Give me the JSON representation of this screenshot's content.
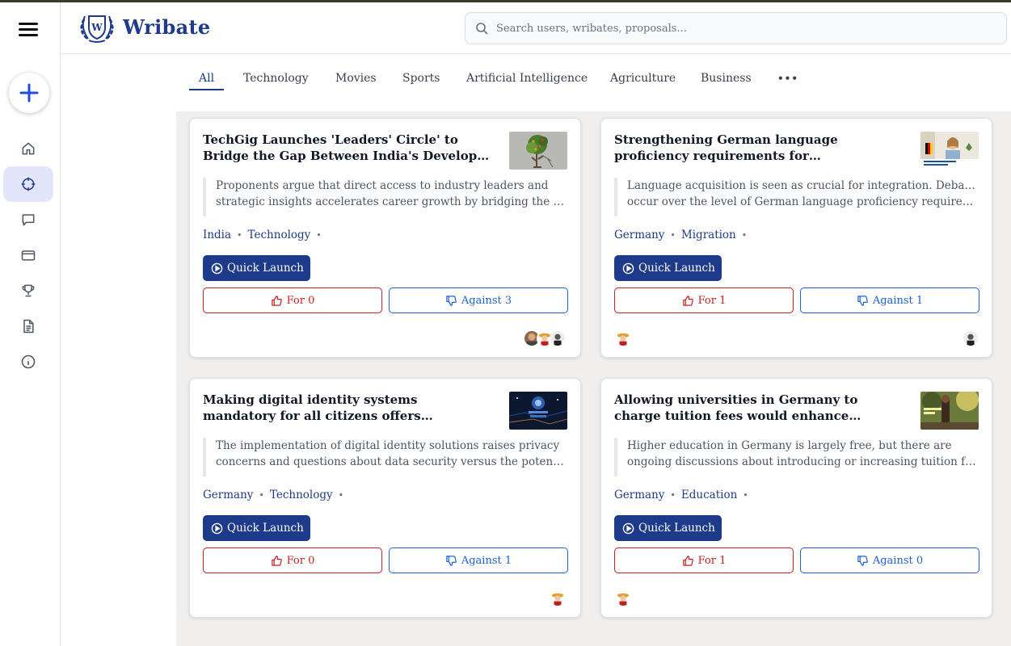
{
  "app": {
    "brand": "Wribate",
    "logo_letter": "W"
  },
  "search": {
    "placeholder": "Search users, wribates, proposals..."
  },
  "sidebar": {
    "items": [
      {
        "name": "home-icon"
      },
      {
        "name": "crosshair-icon",
        "active": true
      },
      {
        "name": "chat-icon"
      },
      {
        "name": "card-icon"
      },
      {
        "name": "trophy-icon"
      },
      {
        "name": "document-icon"
      },
      {
        "name": "info-icon"
      }
    ]
  },
  "tabs": [
    {
      "label": "All",
      "active": true
    },
    {
      "label": "Technology"
    },
    {
      "label": "Movies"
    },
    {
      "label": "Sports"
    },
    {
      "label": "Artificial Intelligence"
    },
    {
      "label": "Agriculture"
    },
    {
      "label": "Business"
    },
    {
      "label": "•••"
    }
  ],
  "cards": [
    {
      "title": "TechGig Launches 'Leaders' Circle' to Bridge the Gap Between India's Developer Community and Industry Leaders",
      "desc_line1": "Proponents argue that direct access to industry leaders and",
      "desc_line2": "strategic insights accelerates career growth by bridging the gap between developers and leadership",
      "tag1": "India",
      "tag2": "Technology",
      "quick_launch": "Quick Launch",
      "for_label": "For 0",
      "against_label": "Against 3",
      "thumb": "tree"
    },
    {
      "title": "Strengthening German language proficiency requirements for naturalization is crucial for integration",
      "desc_line1": "Language acquisition is seen as crucial for integration. Debates",
      "desc_line2": "occur over the level of German language proficiency required for citizenship",
      "tag1": "Germany",
      "tag2": "Migration",
      "quick_launch": "Quick Launch",
      "for_label": "For 1",
      "against_label": "Against 1",
      "thumb": "person"
    },
    {
      "title": "Making digital identity systems mandatory for all citizens offers significant advantages that outweigh the risks",
      "desc_line1": "The implementation of digital identity solutions raises privacy",
      "desc_line2": "concerns and questions about data security versus the potential benefits",
      "tag1": "Germany",
      "tag2": "Technology",
      "quick_launch": "Quick Launch",
      "for_label": "For 0",
      "against_label": "Against 1",
      "thumb": "digital"
    },
    {
      "title": "Allowing universities in Germany to charge tuition fees would enhance educational quality",
      "desc_line1": "Higher education in Germany is largely free, but there are",
      "desc_line2": "ongoing discussions about introducing or increasing tuition fees",
      "tag1": "Germany",
      "tag2": "Education",
      "quick_launch": "Quick Launch",
      "for_label": "For 1",
      "against_label": "Against 0",
      "thumb": "campus"
    }
  ],
  "colors": {
    "primary": "#1e3a8a",
    "for": "#c81e1e",
    "against": "#1d5fd6",
    "content_bg": "#f0efed"
  }
}
